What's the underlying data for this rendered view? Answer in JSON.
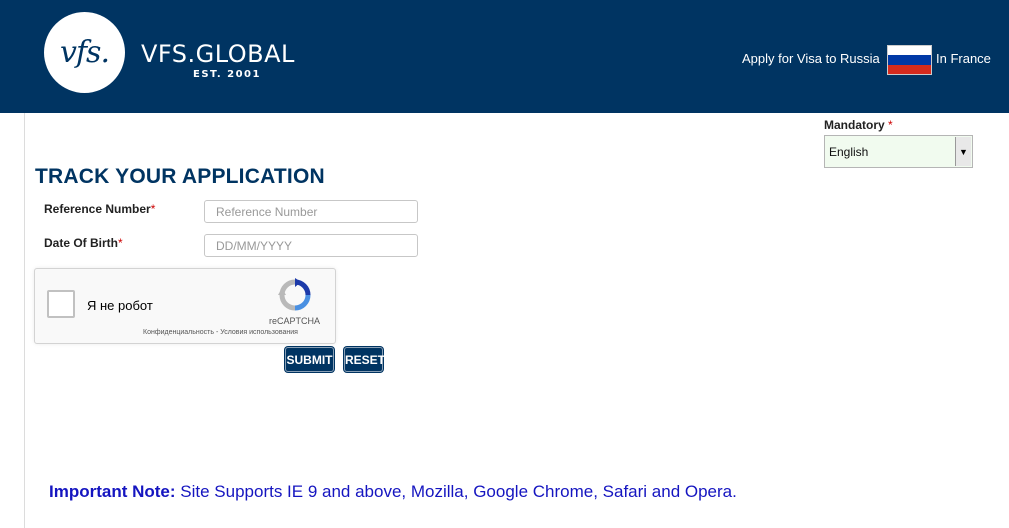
{
  "header": {
    "logo_mark": "vfs.",
    "brand": "VFS.GLOBAL",
    "est": "EST. 2001",
    "apply_text": "Apply for Visa to Russia",
    "country_text": "In France",
    "flag_colors": [
      "#ffffff",
      "#0039a6",
      "#d52b1e"
    ]
  },
  "language": {
    "mandatory_label": "Mandatory",
    "required_mark": "*",
    "selected": "English"
  },
  "form": {
    "title": "TRACK YOUR APPLICATION",
    "reference_label": "Reference Number",
    "reference_placeholder": "Reference Number",
    "dob_label": "Date Of Birth",
    "dob_placeholder": "DD/MM/YYYY",
    "required_mark": "*"
  },
  "recaptcha": {
    "checkbox_label": "Я не робот",
    "brand": "reCAPTCHA",
    "links": "Конфиденциальность - Условия использования"
  },
  "buttons": {
    "submit": "SUBMIT",
    "reset": "RESET"
  },
  "note": {
    "prefix": "Important Note:",
    "text": " Site Supports IE 9 and above, Mozilla, Google Chrome, Safari and Opera."
  },
  "colors": {
    "header_bg": "#003462",
    "note_text": "#1515c0",
    "required": "#cc0000"
  }
}
